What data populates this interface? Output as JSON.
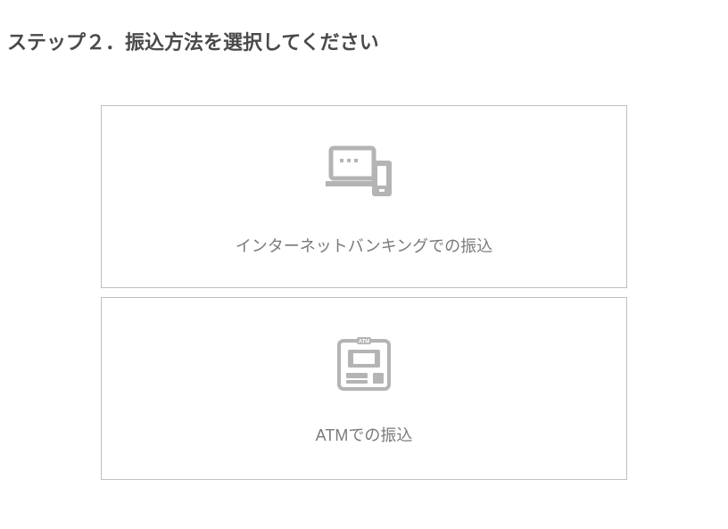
{
  "step_title": "ステップ２．振込方法を選択してください",
  "options": [
    {
      "label": "インターネットバンキングでの振込",
      "icon": "internet-banking-icon"
    },
    {
      "label": "ATMでの振込",
      "icon": "atm-icon"
    }
  ]
}
